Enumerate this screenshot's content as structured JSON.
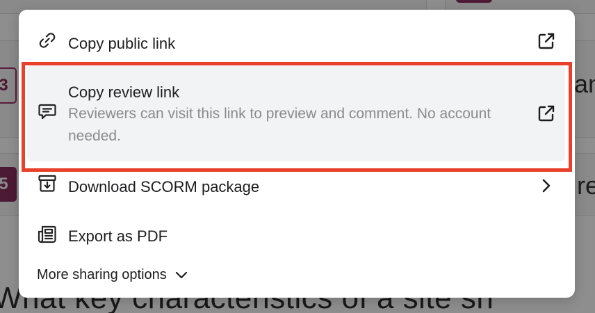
{
  "background": {
    "badge_left_top": "3",
    "badge_left_bottom": "5",
    "right_text_top": "an",
    "right_text_bottom": "re",
    "question_text": "What key characteristics of a site sh"
  },
  "menu": {
    "items": [
      {
        "label": "Copy public link",
        "icon": "link-icon",
        "trailing_icon": "external-link-icon"
      },
      {
        "label": "Copy review link",
        "description": "Reviewers can visit this link to preview and comment. No account needed.",
        "icon": "comment-icon",
        "trailing_icon": "external-link-icon"
      },
      {
        "label": "Download SCORM package",
        "icon": "archive-download-icon",
        "trailing_icon": "chevron-right-icon"
      },
      {
        "label": "Export as PDF",
        "icon": "newspaper-icon"
      }
    ],
    "more_options": {
      "label": "More sharing options",
      "icon": "chevron-down-icon"
    }
  },
  "colors": {
    "highlight": "#e8402a",
    "menu_bg": "#ffffff",
    "hover_bg": "#f2f3f5",
    "badge": "#4d1a35"
  }
}
